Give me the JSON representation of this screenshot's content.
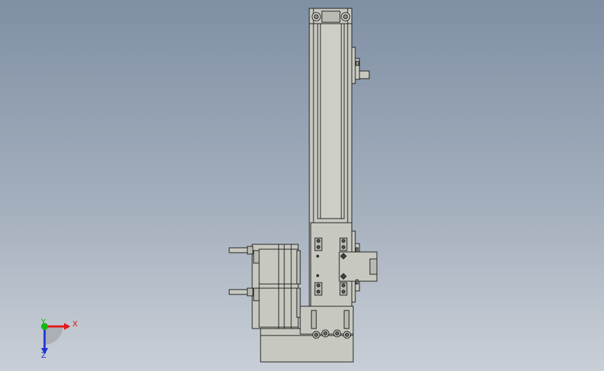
{
  "viewport": {
    "background_top": "#7f8fa4",
    "background_bottom": "#c9cfd7"
  },
  "model": {
    "body_color": "#c7c8bf",
    "edge_color": "#1e1e1e",
    "shade_color": "#a6a79e"
  },
  "triad": {
    "x_label": "X",
    "y_label": "Y",
    "z_label": "Z",
    "x_color": "#e01818",
    "y_color": "#14b814",
    "z_color": "#1c34d6"
  }
}
